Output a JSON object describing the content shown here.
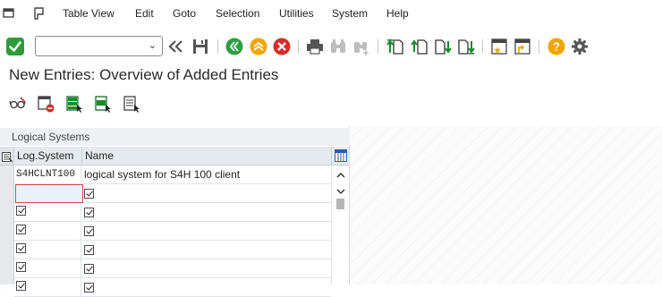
{
  "menubar": {
    "items": [
      "Table View",
      "Edit",
      "Goto",
      "Selection",
      "Utilities",
      "System",
      "Help"
    ]
  },
  "toolbar": {
    "command_field_value": "",
    "icons": [
      "enter-icon",
      "back-double-icon",
      "save-icon",
      "back-icon",
      "exit-icon",
      "cancel-icon",
      "print-icon",
      "find-icon",
      "find-next-icon",
      "first-page-icon",
      "previous-page-icon",
      "next-page-icon",
      "last-page-icon",
      "create-session-icon",
      "generate-shortcut-icon",
      "help-icon",
      "settings-icon"
    ]
  },
  "page": {
    "title": "New Entries: Overview of Added Entries"
  },
  "app_toolbar": {
    "icons": [
      "display-change-icon",
      "delete-icon",
      "select-all-icon",
      "select-block-icon",
      "deselect-all-icon"
    ]
  },
  "table": {
    "title": "Logical Systems",
    "columns": [
      "Log.System",
      "Name"
    ],
    "rows": [
      {
        "log_system": "S4HCLNT100",
        "name": "logical system for S4H 100 client"
      },
      {
        "log_system": "",
        "name": ""
      },
      {
        "log_system": "",
        "name": ""
      },
      {
        "log_system": "",
        "name": ""
      },
      {
        "log_system": "",
        "name": ""
      },
      {
        "log_system": "",
        "name": ""
      },
      {
        "log_system": "",
        "name": ""
      }
    ]
  },
  "colors": {
    "enter_green": "#2e9b3a",
    "nav_green": "#2f9e44",
    "nav_orange": "#f0a500",
    "cancel_red": "#d62c2c",
    "help_orange": "#f0a500",
    "header_bg": "#e5eaef"
  }
}
